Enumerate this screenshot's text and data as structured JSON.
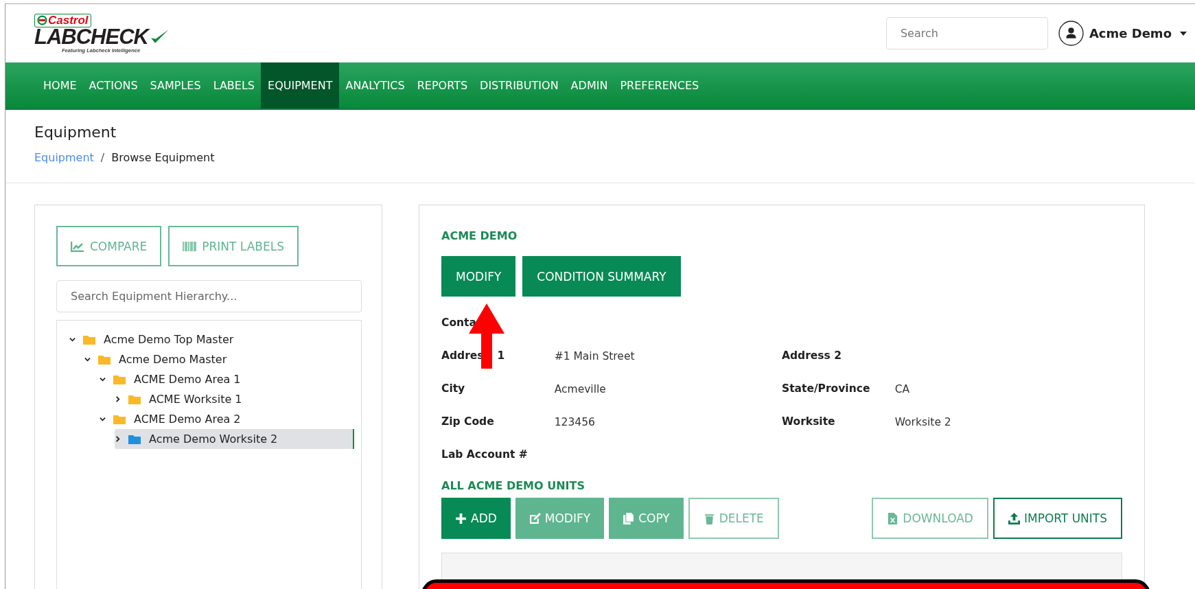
{
  "logo": {
    "brand": "Castrol",
    "product": "LABCHECK",
    "tagline": "Featuring Labcheck Intelligence"
  },
  "header": {
    "search": {
      "placeholder": "Search"
    },
    "user": "Acme Demo"
  },
  "nav": [
    {
      "label": "HOME",
      "selected": false
    },
    {
      "label": "ACTIONS",
      "selected": false
    },
    {
      "label": "SAMPLES",
      "selected": false
    },
    {
      "label": "LABELS",
      "selected": false
    },
    {
      "label": "EQUIPMENT",
      "selected": true
    },
    {
      "label": "ANALYTICS",
      "selected": false
    },
    {
      "label": "REPORTS",
      "selected": false
    },
    {
      "label": "DISTRIBUTION",
      "selected": false
    },
    {
      "label": "ADMIN",
      "selected": false
    },
    {
      "label": "PREFERENCES",
      "selected": false
    }
  ],
  "page": {
    "title": "Equipment",
    "breadcrumb": [
      {
        "label": "Equipment",
        "kind": "link"
      },
      {
        "label": "Browse Equipment",
        "kind": "current"
      }
    ],
    "separator": "/"
  },
  "left_panel": {
    "buttons": [
      {
        "label": "COMPARE",
        "kind": "chart"
      },
      {
        "label": "PRINT LABELS",
        "kind": "barcode"
      }
    ],
    "search": {
      "placeholder": "Search Equipment Hierarchy..."
    },
    "tree": [
      {
        "label": "Acme Demo Top Master",
        "expanded": true,
        "selected": false,
        "children": [
          {
            "label": "Acme Demo Master",
            "expanded": true,
            "selected": false,
            "children": [
              {
                "label": "ACME Demo Area 1",
                "expanded": true,
                "selected": false,
                "children": [
                  {
                    "label": "ACME Worksite 1",
                    "expanded": false,
                    "selected": false
                  }
                ]
              },
              {
                "label": "ACME Demo Area 2",
                "expanded": true,
                "selected": false,
                "children": [
                  {
                    "label": "Acme Demo Worksite 2",
                    "expanded": false,
                    "selected": true
                  }
                ]
              }
            ]
          }
        ]
      }
    ]
  },
  "details": {
    "title": "ACME DEMO",
    "buttons": [
      "MODIFY",
      "CONDITION SUMMARY"
    ],
    "fields": [
      [
        {
          "label": [
            "Conta"
          ]
        }
      ],
      [
        {
          "label": [
            "Addres",
            "1"
          ],
          "value": "#1 Main Street"
        },
        {
          "label": [
            "Address 2"
          ]
        }
      ],
      [
        {
          "label": [
            "City"
          ],
          "value": "Acmeville"
        },
        {
          "label": [
            "State/Province"
          ],
          "value": "CA"
        }
      ],
      [
        {
          "label": [
            "Zip Code"
          ],
          "value": "123456"
        },
        {
          "label": [
            "Worksite"
          ],
          "value": "Worksite 2"
        }
      ],
      [
        {
          "label": [
            "Lab Account #"
          ]
        }
      ]
    ],
    "units_title": "ALL ACME DEMO UNITS",
    "unit_buttons": [
      {
        "label": "ADD",
        "kind": "add",
        "disabled": false
      },
      {
        "label": "MODIFY",
        "kind": "edit",
        "disabled": true
      },
      {
        "label": "COPY",
        "kind": "copy",
        "disabled": true
      },
      {
        "label": "DELETE",
        "kind": "delete",
        "disabled": true
      },
      {
        "label": "DOWNLOAD",
        "kind": "download",
        "disabled": true
      },
      {
        "label": "IMPORT UNITS",
        "kind": "import",
        "disabled": false
      }
    ]
  }
}
